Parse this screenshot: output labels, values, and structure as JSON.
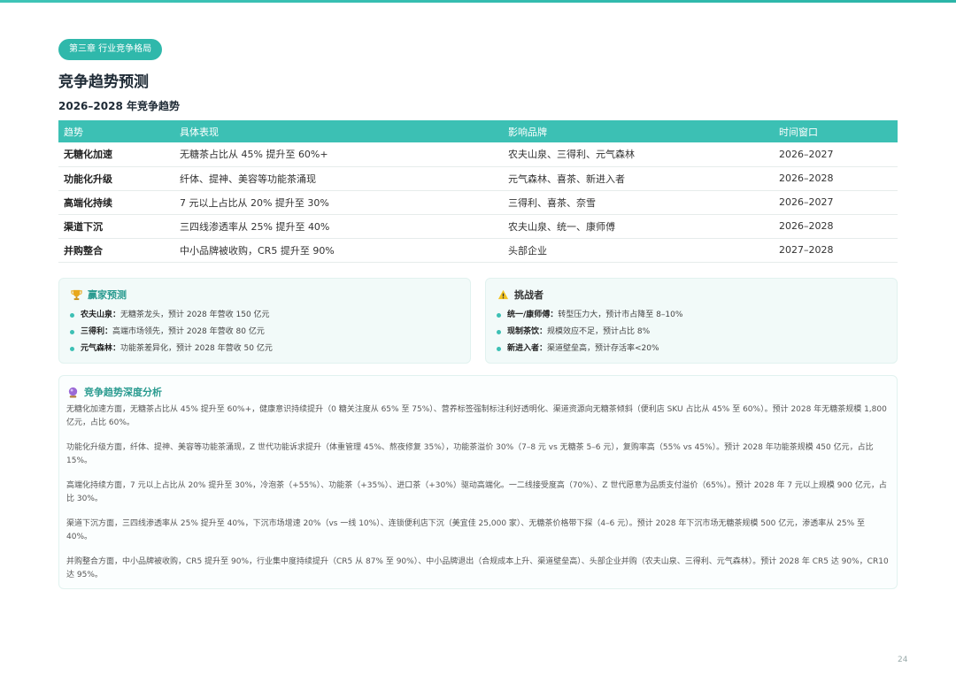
{
  "chapter_label": "第三章 行业竞争格局",
  "page_title": "竞争趋势预测",
  "section_title": "2026–2028 年竞争趋势",
  "table": {
    "headers": [
      "趋势",
      "具体表现",
      "影响品牌",
      "时间窗口"
    ],
    "rows": [
      [
        "无糖化加速",
        "无糖茶占比从 45% 提升至 60%+",
        "农夫山泉、三得利、元气森林",
        "2026–2027"
      ],
      [
        "功能化升级",
        "纤体、提神、美容等功能茶涌现",
        "元气森林、喜茶、新进入者",
        "2026–2028"
      ],
      [
        "高端化持续",
        "7 元以上占比从 20% 提升至 30%",
        "三得利、喜茶、奈雪",
        "2026–2027"
      ],
      [
        "渠道下沉",
        "三四线渗透率从 25% 提升至 40%",
        "农夫山泉、统一、康师傅",
        "2026–2028"
      ],
      [
        "并购整合",
        "中小品牌被收购，CR5 提升至 90%",
        "头部企业",
        "2027–2028"
      ]
    ]
  },
  "winners": {
    "icon": "trophy-icon",
    "title": "赢家预测",
    "items": [
      {
        "key": "农夫山泉：",
        "text": "无糖茶龙头，预计 2028 年营收 150 亿元"
      },
      {
        "key": "三得利：",
        "text": "高端市场领先，预计 2028 年营收 80 亿元"
      },
      {
        "key": "元气森林：",
        "text": "功能茶差异化，预计 2028 年营收 50 亿元"
      }
    ]
  },
  "challengers": {
    "icon": "warning-icon",
    "title": "挑战者",
    "items": [
      {
        "key": "统一/康师傅：",
        "text": "转型压力大，预计市占降至 8–10%"
      },
      {
        "key": "现制茶饮：",
        "text": "规模效应不足，预计占比 8%"
      },
      {
        "key": "新进入者：",
        "text": "渠道壁垒高，预计存活率<20%"
      }
    ]
  },
  "analysis": {
    "icon": "crystal-ball-icon",
    "title": "竞争趋势深度分析",
    "paragraphs": [
      "无糖化加速方面，无糖茶占比从 45% 提升至 60%+，健康意识持续提升（0 糖关注度从 65% 至 75%）、营养标签强制标注利好透明化、渠道资源向无糖茶倾斜（便利店 SKU 占比从 45% 至 60%）。预计 2028 年无糖茶规模 1,800 亿元，占比 60%。",
      "功能化升级方面，纤体、提神、美容等功能茶涌现，Z 世代功能诉求提升（体重管理 45%、熬夜修复 35%），功能茶溢价 30%（7–8 元 vs 无糖茶 5–6 元），复购率高（55% vs 45%）。预计 2028 年功能茶规模 450 亿元，占比 15%。",
      "高端化持续方面，7 元以上占比从 20% 提升至 30%，冷泡茶（+55%）、功能茶（+35%）、进口茶（+30%）驱动高端化。一二线接受度高（70%）、Z 世代愿意为品质支付溢价（65%）。预计 2028 年 7 元以上规模 900 亿元，占比 30%。",
      "渠道下沉方面，三四线渗透率从 25% 提升至 40%，下沉市场增速 20%（vs 一线 10%）、连锁便利店下沉（美宜佳 25,000 家）、无糖茶价格带下探（4–6 元）。预计 2028 年下沉市场无糖茶规模 500 亿元，渗透率从 25% 至 40%。",
      "并购整合方面，中小品牌被收购，CR5 提升至 90%，行业集中度持续提升（CR5 从 87% 至 90%）、中小品牌退出（合规成本上升、渠道壁垒高）、头部企业并购（农夫山泉、三得利、元气森林）。预计 2028 年 CR5 达 90%，CR10 达 95%。"
    ]
  },
  "page_number": "24"
}
